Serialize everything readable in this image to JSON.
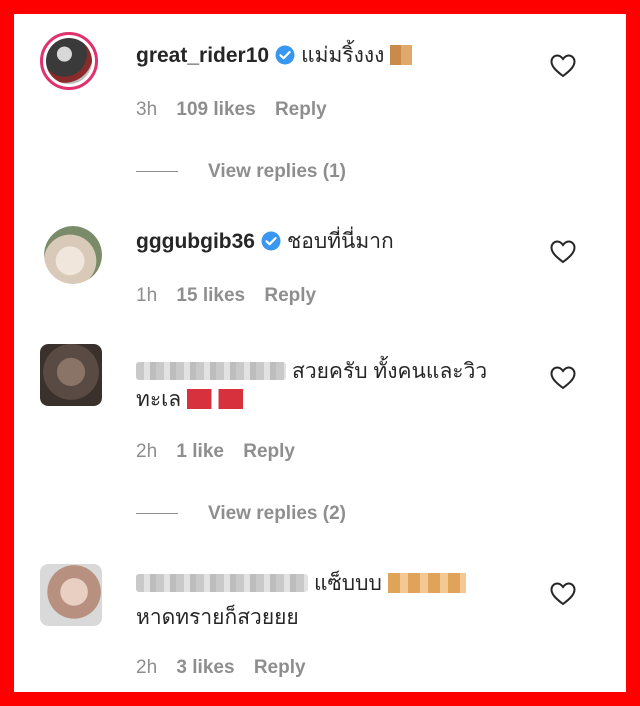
{
  "comments": [
    {
      "username": "great_rider10",
      "verified": true,
      "text": "แม่มริ้งงง",
      "time": "3h",
      "likes": "109 likes",
      "reply": "Reply",
      "view_replies": "View replies (1)"
    },
    {
      "username": "gggubgib36",
      "verified": true,
      "text": "ชอบที่นี่มาก",
      "time": "1h",
      "likes": "15 likes",
      "reply": "Reply"
    },
    {
      "username_blurred": true,
      "text_line1": "สวยครับ ทั้งคนและวิว",
      "text_line2": "ทะเล",
      "time": "2h",
      "likes": "1 like",
      "reply": "Reply",
      "view_replies": "View replies (2)"
    },
    {
      "username_blurred": true,
      "text_line1": "แซ็บบบ",
      "text_line2": "หาดทรายก็สวยยย",
      "time": "2h",
      "likes": "3 likes",
      "reply": "Reply"
    }
  ],
  "icons": {
    "like": "heart-icon",
    "verified": "verified-badge-icon"
  },
  "colors": {
    "border": "#ff0000",
    "verified": "#3897f0",
    "muted": "#8e8e8e",
    "text": "#262626"
  }
}
